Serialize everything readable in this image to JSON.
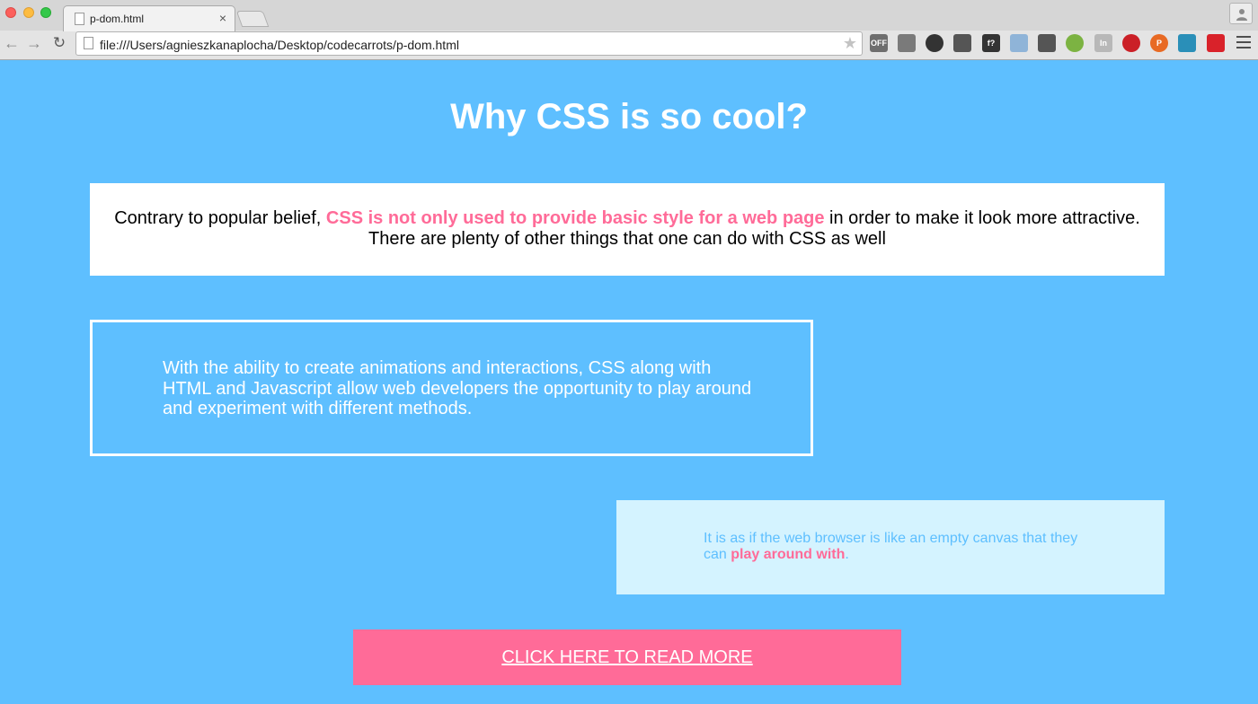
{
  "browser": {
    "tab_title": "p-dom.html",
    "tab_close": "×",
    "url": "file:///Users/agnieszkanaplocha/Desktop/codecarrots/p-dom.html",
    "extensions": [
      {
        "name": "off-extension-icon",
        "label": "OFF",
        "color": "#6e6e6e"
      },
      {
        "name": "bug-extension-icon",
        "label": "",
        "color": "#7a7a7a"
      },
      {
        "name": "color-picker-extension-icon",
        "label": "",
        "color": "#333333"
      },
      {
        "name": "ruler-extension-icon",
        "label": "",
        "color": "#555555"
      },
      {
        "name": "font-extension-icon",
        "label": "f?",
        "color": "#333333"
      },
      {
        "name": "camera-extension-icon",
        "label": "",
        "color": "#8fb4d8"
      },
      {
        "name": "pin-extension-icon",
        "label": "",
        "color": "#555555"
      },
      {
        "name": "circle-extension-icon",
        "label": "",
        "color": "#7cb342"
      },
      {
        "name": "in-extension-icon",
        "label": "In",
        "color": "#b8b8b8"
      },
      {
        "name": "pinterest-extension-icon",
        "label": "",
        "color": "#cb2027"
      },
      {
        "name": "p-extension-icon",
        "label": "P",
        "color": "#e86a24"
      },
      {
        "name": "wave-extension-icon",
        "label": "",
        "color": "#2a8fb8"
      },
      {
        "name": "red-extension-icon",
        "label": "",
        "color": "#d9222a"
      }
    ]
  },
  "page": {
    "title": "Why CSS is so cool?",
    "box1": {
      "text_before": "Contrary to popular belief, ",
      "highlight": "CSS is not only used to provide basic style for a web page",
      "text_after": " in order to make it look more attractive. There are plenty of other things that one can do with CSS as well"
    },
    "box2": {
      "text": "With the ability to create animations and interactions, CSS along with HTML and Javascript allow web developers the opportunity to play around and experiment with different methods."
    },
    "box3": {
      "text_before": "It is as if the web browser is like an empty canvas that they can ",
      "highlight": "play around with",
      "text_after": "."
    },
    "cta_label": "CLICK HERE TO READ MORE"
  },
  "colors": {
    "background": "#5ebfff",
    "accent": "#ff6b98",
    "light_box": "#d4f3ff"
  }
}
